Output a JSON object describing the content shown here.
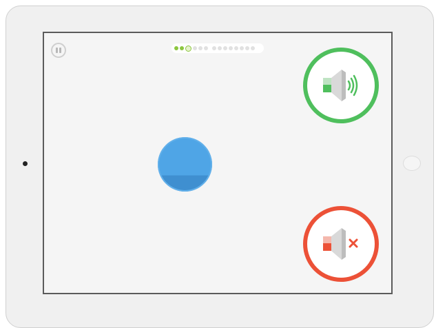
{
  "progress": {
    "completed": 2,
    "current": 3,
    "total": 14
  },
  "icons": {
    "pause": "pause-icon",
    "sound_on": "speaker-sound-icon",
    "sound_off": "speaker-mute-icon",
    "ball": "blue-circle"
  },
  "colors": {
    "sound_on_ring": "#4fbf5d",
    "sound_off_ring": "#ec5137",
    "ball": "#4fa5e6",
    "progress_done": "#8cc63f"
  }
}
